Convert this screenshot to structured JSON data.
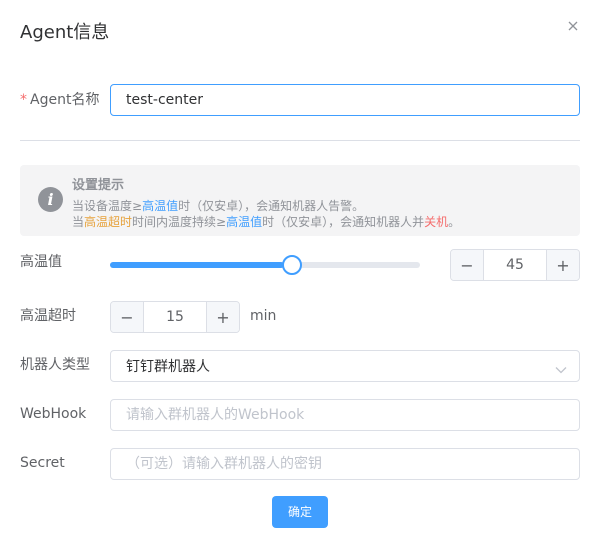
{
  "dialog": {
    "title": "Agent信息"
  },
  "agent_name": {
    "label": "Agent名称",
    "required_mark": "*",
    "value": "test-center"
  },
  "alert": {
    "title": "设置提示",
    "line1_a": "当设备温度≥",
    "line1_b": "高温值",
    "line1_c": "时（仅安卓），会通知机器人告警。",
    "line2_a": "当",
    "line2_b": "高温超时",
    "line2_c": "时间内温度持续≥",
    "line2_d": "高温值",
    "line2_e": "时（仅安卓），会通知机器人并",
    "line2_f": "关机",
    "line2_g": "。"
  },
  "high_temp": {
    "label": "高温值",
    "value": "45",
    "slider_fraction": 0.56,
    "minus": "−",
    "plus": "+"
  },
  "timeout": {
    "label": "高温超时",
    "value": "15",
    "unit": "min",
    "minus": "−",
    "plus": "+"
  },
  "robot_type": {
    "label": "机器人类型",
    "value": "钉钉群机器人"
  },
  "webhook": {
    "label": "WebHook",
    "placeholder": "请输入群机器人的WebHook"
  },
  "secret": {
    "label": "Secret",
    "placeholder": "（可选）请输入群机器人的密钥"
  },
  "footer": {
    "confirm_label": "确定"
  },
  "colors": {
    "primary": "#409eff",
    "warning": "#e6a23c",
    "danger": "#f56c6c",
    "info": "#909399"
  }
}
